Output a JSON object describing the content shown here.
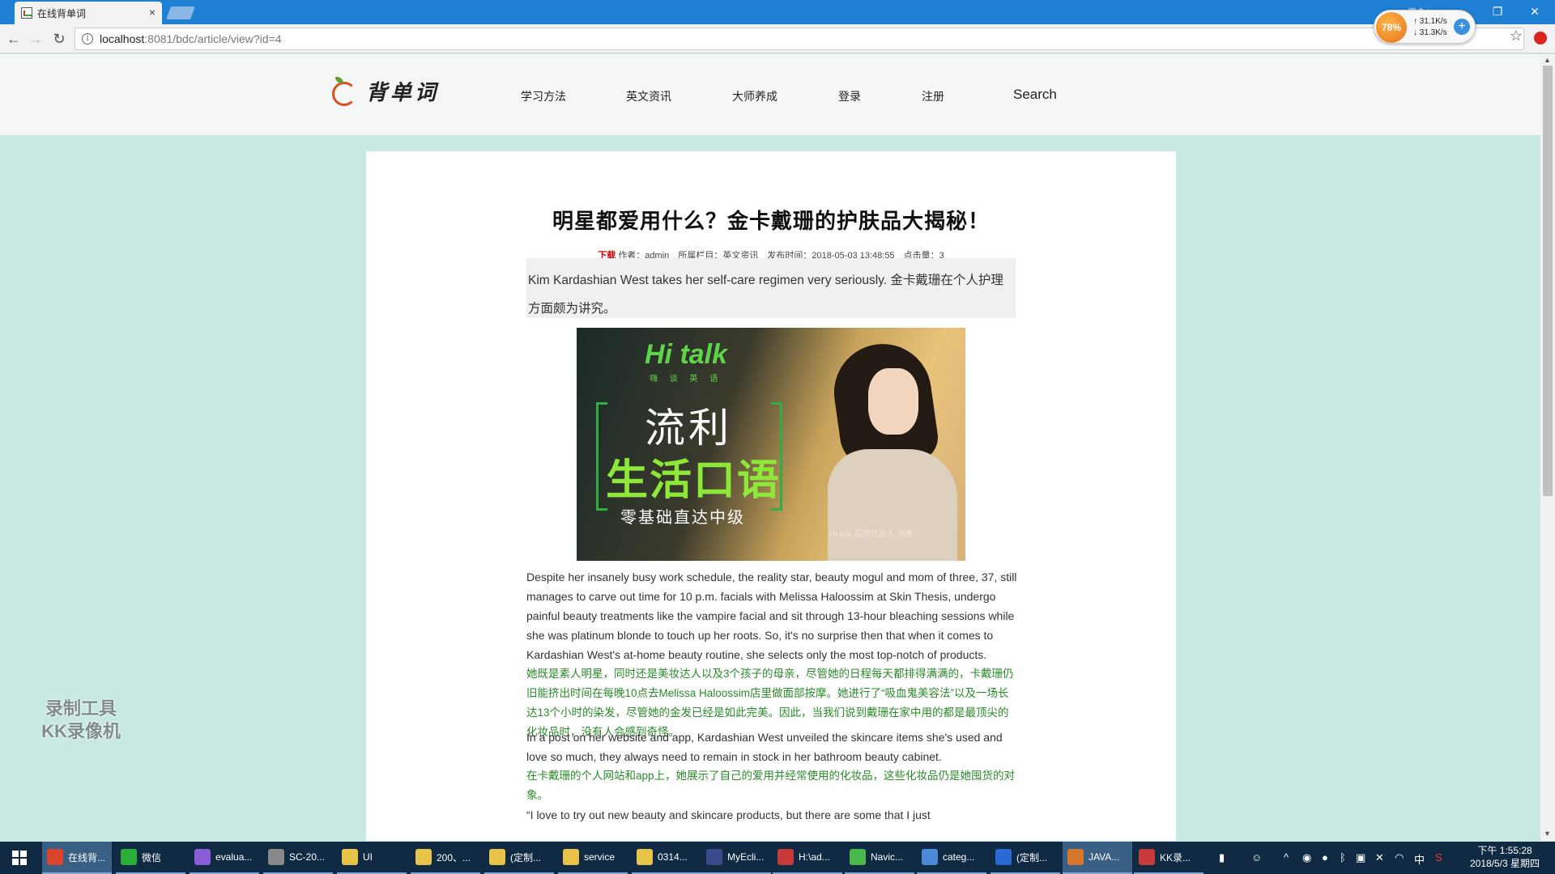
{
  "browser": {
    "tab_title": "在线背单词",
    "tab_close": "×",
    "url_host": "localhost",
    "url_rest": ":8081/bdc/article/view?id=4",
    "window_user": "用户1",
    "controls": {
      "minimize": "–",
      "restore": "❐",
      "close": "✕"
    },
    "nav": {
      "back": "←",
      "forward": "→",
      "reload": "↻"
    },
    "star": "☆"
  },
  "speed_widget": {
    "percent": "78%",
    "upload": "↑ 31.1K/s",
    "download": "↓ 31.3K/s",
    "plus": "+"
  },
  "site": {
    "logo_text": "背单词",
    "nav": [
      "学习方法",
      "英文资讯",
      "大师养成",
      "登录",
      "注册"
    ],
    "search": "Search"
  },
  "article": {
    "title": "明星都爱用什么？金卡戴珊的护肤品大揭秘！",
    "meta": {
      "download": "下载",
      "author": "作者：admin",
      "category": "所属栏目：英文资讯",
      "published": "发布时间：2018-05-03 13:48:55",
      "clicks": "点击量：3"
    },
    "summary": "Kim Kardashian West takes her self-care regimen very seriously. 金卡戴珊在个人护理方面颇为讲究。",
    "image": {
      "brand": "Hi talk",
      "brand_sub": "嗨 谈 英 语",
      "line1": "流利",
      "line2": "生活口语",
      "line3": "零基础直达中级",
      "caption": "Hi talk 品牌代言人 汤唯"
    },
    "paragraphs": [
      {
        "lang": "en",
        "text": "Despite her insanely busy work schedule, the reality star, beauty mogul and mom of three, 37, still manages to carve out time for 10 p.m. facials with Melissa Haloossim at Skin Thesis, undergo painful beauty treatments like the vampire facial and sit through 13-hour bleaching sessions while she was platinum blonde to touch up her roots. So, it's no surprise then that when it comes to Kardashian West's at-home beauty routine, she selects only the most top-notch of products."
      },
      {
        "lang": "cn",
        "text": "她既是素人明星，同时还是美妆达人以及3个孩子的母亲，尽管她的日程每天都排得满满的，卡戴珊仍旧能挤出时间在每晚10点去Melissa Haloossim店里做面部按摩。她进行了“吸血鬼美容法”以及一场长达13个小时的染发，尽管她的金发已经是如此完美。因此，当我们说到戴珊在家中用的都是最顶尖的化妆品时，没有人会感到奇怪。"
      },
      {
        "lang": "en",
        "text": "In a post on her website and app, Kardashian West unveiled the skincare items she's used and love so much, they always need to remain in stock in her bathroom beauty cabinet."
      },
      {
        "lang": "cn",
        "text": "在卡戴珊的个人网站和app上，她展示了自己的爱用并经常使用的化妆品，这些化妆品仍是她囤货的对象。"
      },
      {
        "lang": "en",
        "text": "“I love to try out new beauty and skincare products, but there are some that I just"
      }
    ]
  },
  "watermark": {
    "line1": "录制工具",
    "line2": "KK录像机"
  },
  "taskbar": {
    "items": [
      {
        "label": "在线背...",
        "color": "#d9442c"
      },
      {
        "label": "微信",
        "color": "#2aae3a"
      },
      {
        "label": "evalua...",
        "color": "#8a5bd6"
      },
      {
        "label": "SC-20...",
        "color": "#888888"
      },
      {
        "label": "UI",
        "color": "#e8c34a"
      },
      {
        "label": "200、...",
        "color": "#e8c34a"
      },
      {
        "label": "(定制...",
        "color": "#e8c34a"
      },
      {
        "label": "service",
        "color": "#e8c34a"
      },
      {
        "label": "0314...",
        "color": "#e8c34a"
      },
      {
        "label": "MyEcli...",
        "color": "#3a4a8a"
      },
      {
        "label": "H:\\ad...",
        "color": "#c83a3a"
      },
      {
        "label": "Navic...",
        "color": "#4ab84a"
      },
      {
        "label": "categ...",
        "color": "#4a8ad6"
      },
      {
        "label": "(定制...",
        "color": "#2a6ad6"
      },
      {
        "label": "JAVA...",
        "color": "#d6762a"
      },
      {
        "label": "KK录...",
        "color": "#c83a3a"
      }
    ],
    "tray": {
      "ime": "中",
      "time": "下午 1:55:28",
      "date": "2018/5/3 星期四"
    }
  }
}
